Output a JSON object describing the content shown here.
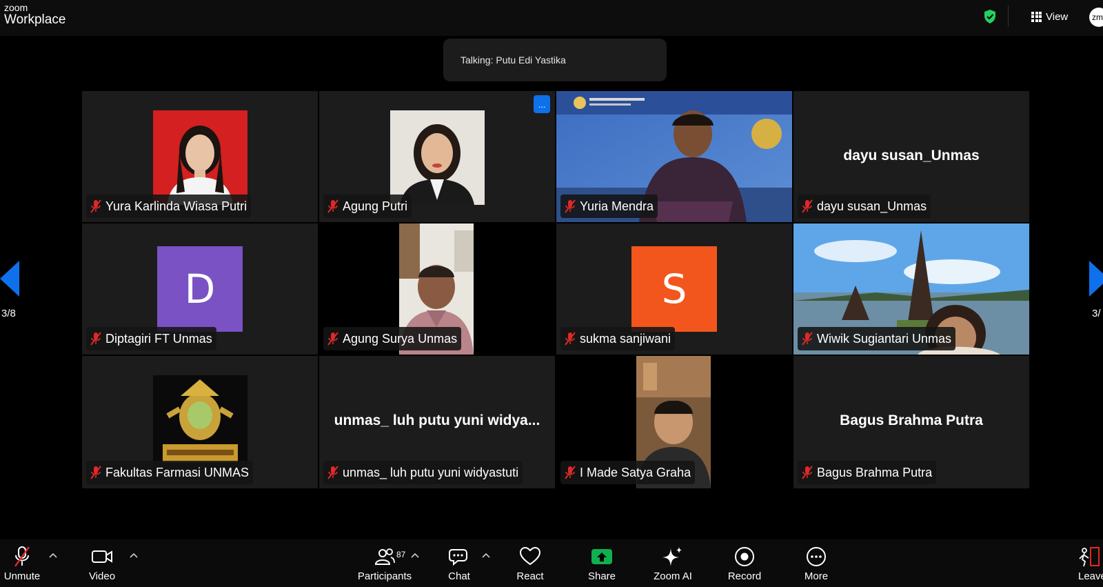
{
  "app": {
    "brand_small": "zoom",
    "brand_big": "Workplace",
    "view_label": "View",
    "account_initials": "zm"
  },
  "talking": {
    "text": "Talking: Putu Edi Yastika"
  },
  "pagination": {
    "left_label": "3/8",
    "right_label": "3/"
  },
  "tiles": [
    {
      "name": "Yura Karlinda Wiasa Putri"
    },
    {
      "name": "Agung Putri",
      "more_label": "..."
    },
    {
      "name": "Yuria Mendra"
    },
    {
      "name": "dayu susan_Unmas",
      "center_name": "dayu susan_Unmas"
    },
    {
      "name": "Diptagiri FT Unmas",
      "avatar_letter": "D",
      "avatar_color": "#7b52c4"
    },
    {
      "name": "Agung Surya Unmas"
    },
    {
      "name": "sukma sanjiwani",
      "avatar_letter": "S",
      "avatar_color": "#f2561d"
    },
    {
      "name": "Wiwik Sugiantari Unmas"
    },
    {
      "name": "Fakultas Farmasi UNMAS"
    },
    {
      "name": "unmas_ luh putu yuni widyastuti",
      "center_name": "unmas_ luh putu yuni widya..."
    },
    {
      "name": "I Made Satya Graha"
    },
    {
      "name": "Bagus Brahma Putra",
      "center_name": "Bagus Brahma Putra"
    }
  ],
  "toolbar": {
    "unmute": "Unmute",
    "video": "Video",
    "participants": "Participants",
    "participants_count": "87",
    "chat": "Chat",
    "react": "React",
    "share": "Share",
    "zoom_ai": "Zoom AI",
    "record": "Record",
    "more": "More",
    "leave": "Leave"
  },
  "colors": {
    "accent_blue": "#0e71eb",
    "share_green": "#0fb04f",
    "muted_red": "#e02828",
    "shield_green": "#23d160"
  }
}
